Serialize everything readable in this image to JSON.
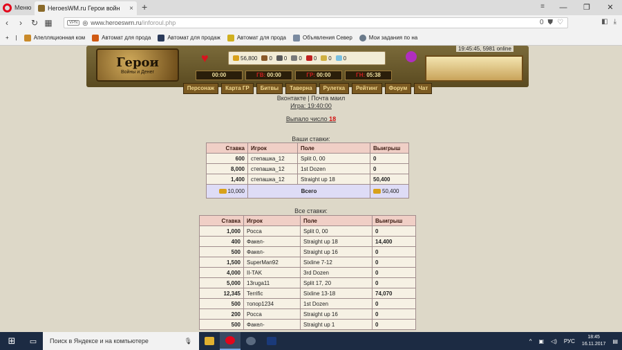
{
  "browser": {
    "menu_label": "Меню",
    "tab_title": "HeroesWM.ru Герои войн",
    "tab_close": "×",
    "new_tab": "+",
    "url_vpn": "VPN",
    "url_host": "www.heroeswm.ru",
    "url_path": "/inforoul.php",
    "url_counter": "0",
    "window_controls": [
      "—",
      "❐",
      "✕"
    ]
  },
  "bookmarks": [
    {
      "label": "Апелляционная ком",
      "color": "#c98a2a"
    },
    {
      "label": "Автомат для прода",
      "color": "#d05a14"
    },
    {
      "label": "Автомат для продаж",
      "color": "#2a3a5a"
    },
    {
      "label": "Автомат для прода",
      "color": "#d0b020"
    },
    {
      "label": "Объявления Север",
      "color": "#7a8aa0"
    },
    {
      "label": "Мои задания по на",
      "color": "#6a7a8a"
    }
  ],
  "game": {
    "logo_title": "Герои",
    "logo_subtitle": "Войны и Денег",
    "clock": "19:45:45, 5981 online",
    "resources": [
      {
        "value": "56,800",
        "color": "#d8a11a"
      },
      {
        "value": "0",
        "color": "#8a5a2a"
      },
      {
        "value": "0",
        "color": "#5a5a5a"
      },
      {
        "value": "0",
        "color": "#7a7a7a"
      },
      {
        "value": "0",
        "color": "#c02020"
      },
      {
        "value": "0",
        "color": "#d0b040"
      },
      {
        "value": "0",
        "color": "#7ac0e0"
      }
    ],
    "timers": [
      {
        "label": "",
        "value": "00:00"
      },
      {
        "label": "ГВ:",
        "value": "00:00"
      },
      {
        "label": "ГР:",
        "value": "00:00"
      },
      {
        "label": "ГН:",
        "value": "05:38"
      }
    ],
    "menu": [
      "Персонаж",
      "Карта ГР",
      "Битвы",
      "Таверна",
      "Рулетка",
      "Рейтинг",
      "Форум",
      "Чат"
    ]
  },
  "roulette": {
    "link_vk": "Вконтакте",
    "link_sep": "|",
    "link_mail": "Почта маил",
    "game_time": "Игра: 19:40:00",
    "result_label": "Выпало число",
    "result_number": "18",
    "your_bets_caption": "Ваши ставки:",
    "all_bets_caption": "Все ставки:",
    "columns": [
      "Ставка",
      "Игрок",
      "Поле",
      "Выигрыш"
    ],
    "your_bets": [
      {
        "stake": "600",
        "player": "степашка_12",
        "field": "Split 0, 00",
        "win": "0"
      },
      {
        "stake": "8,000",
        "player": "степашка_12",
        "field": "1st Dozen",
        "win": "0"
      },
      {
        "stake": "1,400",
        "player": "степашка_12",
        "field": "Straight up 18",
        "win": "50,400"
      }
    ],
    "your_total": {
      "stake": "10,000",
      "label": "Всего",
      "win": "50,400"
    },
    "all_bets": [
      {
        "stake": "1,000",
        "player": "Росса",
        "field": "Split 0, 00",
        "win": "0"
      },
      {
        "stake": "400",
        "player": "Факел-",
        "field": "Straight up 18",
        "win": "14,400"
      },
      {
        "stake": "500",
        "player": "Факел-",
        "field": "Straight up 16",
        "win": "0"
      },
      {
        "stake": "1,500",
        "player": "SuperMan92",
        "field": "Sixline 7-12",
        "win": "0"
      },
      {
        "stake": "4,000",
        "player": "II-TAK",
        "field": "3rd Dozen",
        "win": "0"
      },
      {
        "stake": "5,000",
        "player": "13ruga11",
        "field": "Split 17, 20",
        "win": "0"
      },
      {
        "stake": "12,345",
        "player": "Terrific",
        "field": "Sixline 13-18",
        "win": "74,070"
      },
      {
        "stake": "500",
        "player": "топор1234",
        "field": "1st Dozen",
        "win": "0"
      },
      {
        "stake": "200",
        "player": "Росса",
        "field": "Straight up 16",
        "win": "0"
      },
      {
        "stake": "500",
        "player": "Факел-",
        "field": "Straight up 1",
        "win": "0"
      }
    ]
  },
  "taskbar": {
    "search_placeholder": "Поиск в Яндексе и на компьютере",
    "lang": "РУС",
    "time": "18:45",
    "date": "16.11.2017",
    "apps": [
      {
        "name": "explorer",
        "color": "#e0b030"
      },
      {
        "name": "opera",
        "color": "#e3051b"
      },
      {
        "name": "steam",
        "color": "#5a6a80"
      },
      {
        "name": "photoshop",
        "color": "#1a3a7a"
      }
    ]
  }
}
